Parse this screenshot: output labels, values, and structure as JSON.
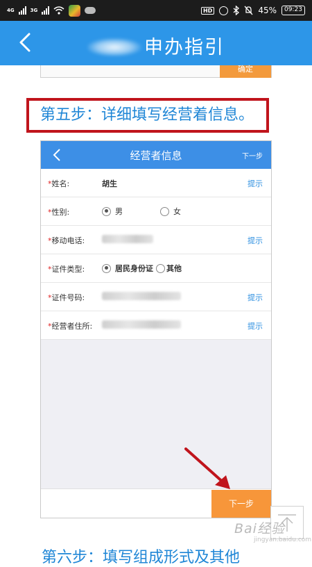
{
  "statusbar": {
    "net1": "4G",
    "net2": "3G",
    "hd": "HD",
    "battery": "45%",
    "time": "09:23"
  },
  "header": {
    "title_blurred_prefix_hidden": true,
    "title": "申办指引"
  },
  "prev_step": {
    "button_label": "确定"
  },
  "step5": {
    "text": "第五步：详细填写经营着信息。"
  },
  "form": {
    "title": "经营者信息",
    "next_top": "下一步",
    "fields": [
      {
        "label": "姓名:",
        "value": "胡生",
        "hint": "提示"
      },
      {
        "label": "性别:",
        "options": [
          "男",
          "女"
        ],
        "selected": "男"
      },
      {
        "label": "移动电话:",
        "hint": "提示"
      },
      {
        "label": "证件类型:",
        "options": [
          "居民身份证",
          "其他"
        ],
        "selected": "居民身份证"
      },
      {
        "label": "证件号码:",
        "hint": "提示"
      },
      {
        "label": "经营者住所:",
        "hint": "提示"
      }
    ],
    "required_mark": "*",
    "next_button": "下一步"
  },
  "watermark": {
    "text": "Bai",
    "text2": "经验",
    "sub": "jingyan.baidu.com"
  },
  "step6": {
    "text": "第六步：填写组成形式及其他"
  },
  "colors": {
    "header_blue": "#2d96e8",
    "accent_orange": "#f7963a",
    "highlight_red": "#c0141c",
    "link_blue": "#2d8fe0"
  }
}
